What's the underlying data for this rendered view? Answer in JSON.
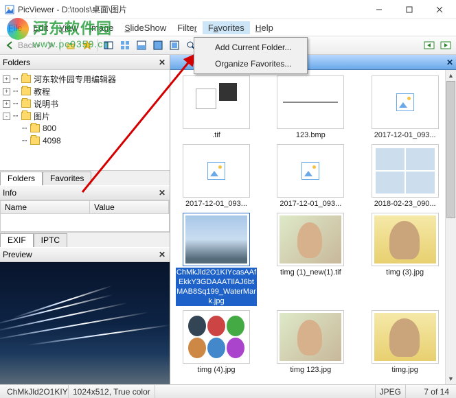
{
  "window": {
    "app": "PicViewer",
    "path": "D:\\tools\\桌面\\图片"
  },
  "menu": {
    "file": "File",
    "edit": "Edit",
    "view": "View",
    "image": "Image",
    "slideshow": "SlideShow",
    "filter": "Filter",
    "favorites": "Favorites",
    "help": "Help"
  },
  "toolbar": {
    "back": "Back"
  },
  "favorites_menu": {
    "add": "Add Current Folder...",
    "organize": "Organize Favorites..."
  },
  "left": {
    "folders_title": "Folders",
    "tree": [
      {
        "exp": "+",
        "label": "河东软件园专用编辑器",
        "indent": 0
      },
      {
        "exp": "+",
        "label": "教程",
        "indent": 0
      },
      {
        "exp": "+",
        "label": "说明书",
        "indent": 0
      },
      {
        "exp": "-",
        "label": "图片",
        "indent": 0
      },
      {
        "exp": "",
        "label": "800",
        "indent": 1
      },
      {
        "exp": "",
        "label": "4098",
        "indent": 1
      }
    ],
    "tabs": {
      "folders": "Folders",
      "favorites": "Favorites"
    },
    "info_title": "Info",
    "info_cols": {
      "name": "Name",
      "value": "Value"
    },
    "tabs2": {
      "exif": "EXIF",
      "iptc": "IPTC"
    },
    "preview_title": "Preview"
  },
  "files": [
    {
      "name": ".tif",
      "kind": "tif"
    },
    {
      "name": "123.bmp",
      "kind": "bmp"
    },
    {
      "name": "2017-12-01_093...",
      "kind": "ph"
    },
    {
      "name": "2017-12-01_093...",
      "kind": "ph"
    },
    {
      "name": "2017-12-01_093...",
      "kind": "ph"
    },
    {
      "name": "2018-02-23_090...",
      "kind": "grid"
    },
    {
      "name": "ChMkJld2O1KIYcasAAfEkkY3GDAAATIlAJ6btMAB8Sq199_WaterMark.jpg",
      "kind": "sky",
      "selected": true
    },
    {
      "name": "timg (1)_new(1).tif",
      "kind": "woman1"
    },
    {
      "name": "timg (3).jpg",
      "kind": "woman2"
    },
    {
      "name": "timg (4).jpg",
      "kind": "circles"
    },
    {
      "name": "timg 123.jpg",
      "kind": "woman1"
    },
    {
      "name": "timg.jpg",
      "kind": "woman2"
    }
  ],
  "status": {
    "file": "ChMkJld2O1KIY",
    "dim": "1024x512, True color",
    "fmt": "JPEG",
    "count": "7 of 14"
  },
  "watermark": {
    "cn": "河东软件园",
    "en": "www.pc0359.cn"
  }
}
